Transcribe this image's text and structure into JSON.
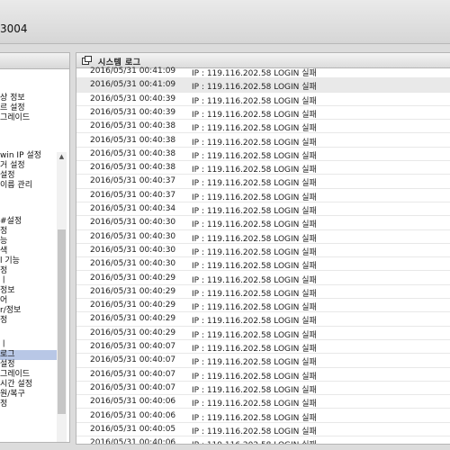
{
  "header": {
    "model_suffix": "3004"
  },
  "panel": {
    "title": "시스템 로그"
  },
  "left_menu": [
    "상 정보",
    "르 설정",
    "그레이드",
    "win IP 설정",
    "거 설정",
    "설정",
    "이름 관리",
    "#설정",
    "정",
    "능",
    "색",
    "l 기능",
    "정",
    "ㅣ",
    "정보",
    "어",
    "r/정보",
    "정",
    "ㅣ",
    "로그",
    "설정",
    "그레이드",
    "시간 설정",
    "원/복구",
    "정"
  ],
  "selected_menu_index": 19,
  "logs": [
    {
      "time": "2016/05/31 00:41:09",
      "msg": "IP : 119.116.202.58 LOGIN 실패"
    },
    {
      "time": "2016/05/31 00:41:09",
      "msg": "IP : 119.116.202.58 LOGIN 실패"
    },
    {
      "time": "2016/05/31 00:40:39",
      "msg": "IP : 119.116.202.58 LOGIN 실패"
    },
    {
      "time": "2016/05/31 00:40:39",
      "msg": "IP : 119.116.202.58 LOGIN 실패"
    },
    {
      "time": "2016/05/31 00:40:38",
      "msg": "IP : 119.116.202.58 LOGIN 실패"
    },
    {
      "time": "2016/05/31 00:40:38",
      "msg": "IP : 119.116.202.58 LOGIN 실패"
    },
    {
      "time": "2016/05/31 00:40:38",
      "msg": "IP : 119.116.202.58 LOGIN 실패"
    },
    {
      "time": "2016/05/31 00:40:38",
      "msg": "IP : 119.116.202.58 LOGIN 실패"
    },
    {
      "time": "2016/05/31 00:40:37",
      "msg": "IP : 119.116.202.58 LOGIN 실패"
    },
    {
      "time": "2016/05/31 00:40:37",
      "msg": "IP : 119.116.202.58 LOGIN 실패"
    },
    {
      "time": "2016/05/31 00:40:34",
      "msg": "IP : 119.116.202.58 LOGIN 실패"
    },
    {
      "time": "2016/05/31 00:40:30",
      "msg": "IP : 119.116.202.58 LOGIN 실패"
    },
    {
      "time": "2016/05/31 00:40:30",
      "msg": "IP : 119.116.202.58 LOGIN 실패"
    },
    {
      "time": "2016/05/31 00:40:30",
      "msg": "IP : 119.116.202.58 LOGIN 실패"
    },
    {
      "time": "2016/05/31 00:40:30",
      "msg": "IP : 119.116.202.58 LOGIN 실패"
    },
    {
      "time": "2016/05/31 00:40:29",
      "msg": "IP : 119.116.202.58 LOGIN 실패"
    },
    {
      "time": "2016/05/31 00:40:29",
      "msg": "IP : 119.116.202.58 LOGIN 실패"
    },
    {
      "time": "2016/05/31 00:40:29",
      "msg": "IP : 119.116.202.58 LOGIN 실패"
    },
    {
      "time": "2016/05/31 00:40:29",
      "msg": "IP : 119.116.202.58 LOGIN 실패"
    },
    {
      "time": "2016/05/31 00:40:29",
      "msg": "IP : 119.116.202.58 LOGIN 실패"
    },
    {
      "time": "2016/05/31 00:40:07",
      "msg": "IP : 119.116.202.58 LOGIN 실패"
    },
    {
      "time": "2016/05/31 00:40:07",
      "msg": "IP : 119.116.202.58 LOGIN 실패"
    },
    {
      "time": "2016/05/31 00:40:07",
      "msg": "IP : 119.116.202.58 LOGIN 실패"
    },
    {
      "time": "2016/05/31 00:40:07",
      "msg": "IP : 119.116.202.58 LOGIN 실패"
    },
    {
      "time": "2016/05/31 00:40:06",
      "msg": "IP : 119.116.202.58 LOGIN 실패"
    },
    {
      "time": "2016/05/31 00:40:06",
      "msg": "IP : 119.116.202.58 LOGIN 실패"
    },
    {
      "time": "2016/05/31 00:40:05",
      "msg": "IP : 119.116.202.58 LOGIN 실패"
    },
    {
      "time": "2016/05/31 00:40:06",
      "msg": "IP : 119.116.202.58 LOGIN 실패"
    },
    {
      "time": "2016/05/31 00:40:05",
      "msg": "IP : 119.116.202.58 LOGIN 실패"
    }
  ],
  "highlighted_row_index": 1
}
